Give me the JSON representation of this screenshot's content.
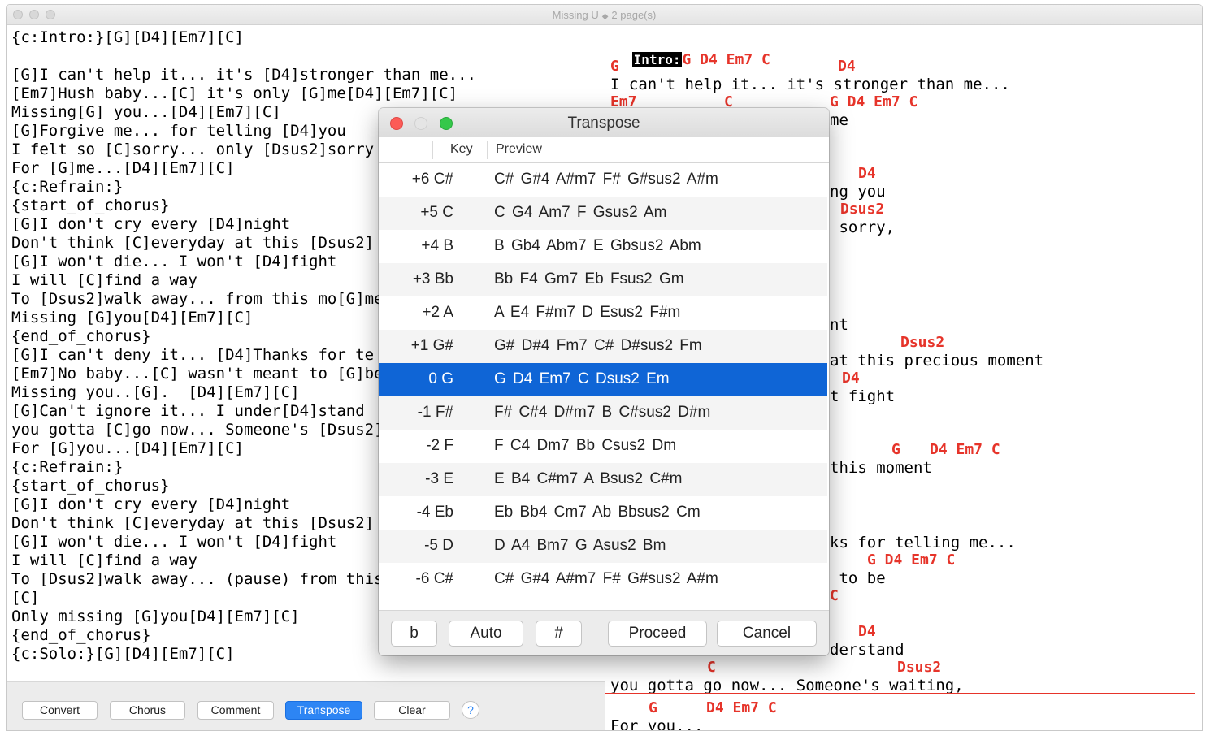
{
  "window": {
    "title": "Missing U",
    "pages": "2 page(s)"
  },
  "source_lines": [
    "{c:Intro:}[G][D4][Em7][C]",
    "",
    "[G]I can't help it... it's [D4]stronger than me...",
    "[Em7]Hush baby...[C] it's only [G]me[D4][Em7][C]",
    "Missing[G] you...[D4][Em7][C]",
    "[G]Forgive me... for telling [D4]you",
    "I felt so [C]sorry... only [Dsus2]sorry",
    "For [G]me...[D4][Em7][C]",
    "{c:Refrain:}",
    "{start_of_chorus}",
    "[G]I don't cry every [D4]night",
    "Don't think [C]everyday at this [Dsus2]",
    "[G]I won't die... I won't [D4]fight",
    "I will [C]find a way",
    "To [Dsus2]walk away... from this mo[G]ment",
    "Missing [G]you[D4][Em7][C]",
    "{end_of_chorus}",
    "[G]I can't deny it... [D4]Thanks for te",
    "[Em7]No baby...[C] wasn't meant to [G]be",
    "Missing you..[G].  [D4][Em7][C]",
    "[G]Can't ignore it... I under[D4]stand",
    "you gotta [C]go now... Someone's [Dsus2]",
    "For [G]you...[D4][Em7][C]",
    "{c:Refrain:}",
    "{start_of_chorus}",
    "[G]I don't cry every [D4]night",
    "Don't think [C]everyday at this [Dsus2]",
    "[G]I won't die... I won't [D4]fight",
    "I will [C]find a way",
    "To [Dsus2]walk away... (pause) from this",
    "[C]",
    "Only missing [G]you[D4][Em7][C]",
    "{end_of_chorus}",
    "{c:Solo:}[G][D4][Em7][C]"
  ],
  "toolbar": {
    "convert": "Convert",
    "chorus": "Chorus",
    "comment": "Comment",
    "transpose": "Transpose",
    "clear": "Clear",
    "help": "?"
  },
  "preview": {
    "intro_label": "Intro:",
    "intro_chords": "G D4 Em7 C",
    "items": [
      {
        "type": "chord",
        "text": "G"
      },
      {
        "type": "chord",
        "text": "D4"
      },
      {
        "type": "lyric",
        "text": "I can't help it... it's stronger than me..."
      },
      {
        "type": "chord",
        "text": "Em7"
      },
      {
        "type": "chord",
        "text": "C"
      },
      {
        "type": "chord",
        "text": "G D4 Em7 C"
      },
      {
        "type": "lyric",
        "text": "me"
      },
      {
        "type": "chord",
        "text": "D4"
      },
      {
        "type": "lyric",
        "text": "ng you"
      },
      {
        "type": "chord",
        "text": "Dsus2"
      },
      {
        "type": "lyric",
        "text": " sorry,"
      },
      {
        "type": "lyric",
        "text": "nt"
      },
      {
        "type": "chord",
        "text": "Dsus2"
      },
      {
        "type": "lyric",
        "text": "at this precious moment"
      },
      {
        "type": "chord",
        "text": "D4"
      },
      {
        "type": "lyric",
        "text": "t fight"
      },
      {
        "type": "chord",
        "text": "G"
      },
      {
        "type": "chord",
        "text": "D4 Em7 C"
      },
      {
        "type": "lyric",
        "text": "this moment"
      },
      {
        "type": "lyric",
        "text": "ks for telling me..."
      },
      {
        "type": "chord",
        "text": "G D4 Em7 C"
      },
      {
        "type": "lyric",
        "text": " to be"
      },
      {
        "type": "chord",
        "text": "C"
      },
      {
        "type": "chord",
        "text": "D4"
      },
      {
        "type": "lyric",
        "text": "derstand"
      },
      {
        "type": "chord",
        "text": "C"
      },
      {
        "type": "chord",
        "text": "Dsus2"
      },
      {
        "type": "lyric",
        "text": "you gotta go now... Someone's waiting,"
      },
      {
        "type": "chord",
        "text": "G"
      },
      {
        "type": "chord",
        "text": "D4 Em7 C"
      },
      {
        "type": "lyric",
        "text": "For you..."
      }
    ]
  },
  "dialog": {
    "title": "Transpose",
    "col_key": "Key",
    "col_preview": "Preview",
    "rows": [
      {
        "key": "+6 C#",
        "preview": "C# G#4 A#m7 F# G#sus2 A#m"
      },
      {
        "key": "+5 C",
        "preview": "C G4 Am7 F Gsus2 Am"
      },
      {
        "key": "+4 B",
        "preview": "B Gb4 Abm7 E Gbsus2 Abm"
      },
      {
        "key": "+3 Bb",
        "preview": "Bb F4 Gm7 Eb Fsus2 Gm"
      },
      {
        "key": "+2 A",
        "preview": "A E4 F#m7 D Esus2 F#m"
      },
      {
        "key": "+1 G#",
        "preview": "G# D#4 Fm7 C# D#sus2 Fm"
      },
      {
        "key": "0 G",
        "preview": "G D4 Em7 C Dsus2 Em",
        "selected": true
      },
      {
        "key": "-1 F#",
        "preview": "F# C#4 D#m7 B C#sus2 D#m"
      },
      {
        "key": "-2 F",
        "preview": "F C4 Dm7 Bb Csus2 Dm"
      },
      {
        "key": "-3 E",
        "preview": "E B4 C#m7 A Bsus2 C#m"
      },
      {
        "key": "-4 Eb",
        "preview": "Eb Bb4 Cm7 Ab Bbsus2 Cm"
      },
      {
        "key": "-5 D",
        "preview": "D A4 Bm7 G Asus2 Bm"
      },
      {
        "key": "-6 C#",
        "preview": "C# G#4 A#m7 F# G#sus2 A#m"
      }
    ],
    "buttons": {
      "flat": "b",
      "auto": "Auto",
      "sharp": "#",
      "proceed": "Proceed",
      "cancel": "Cancel"
    }
  },
  "colors": {
    "accent": "#2d85f4",
    "selection": "#0f65d6",
    "chord": "#e6342a",
    "close": "#fc5b57",
    "minimize": "#e5e5e5",
    "zoom": "#35c84a"
  }
}
